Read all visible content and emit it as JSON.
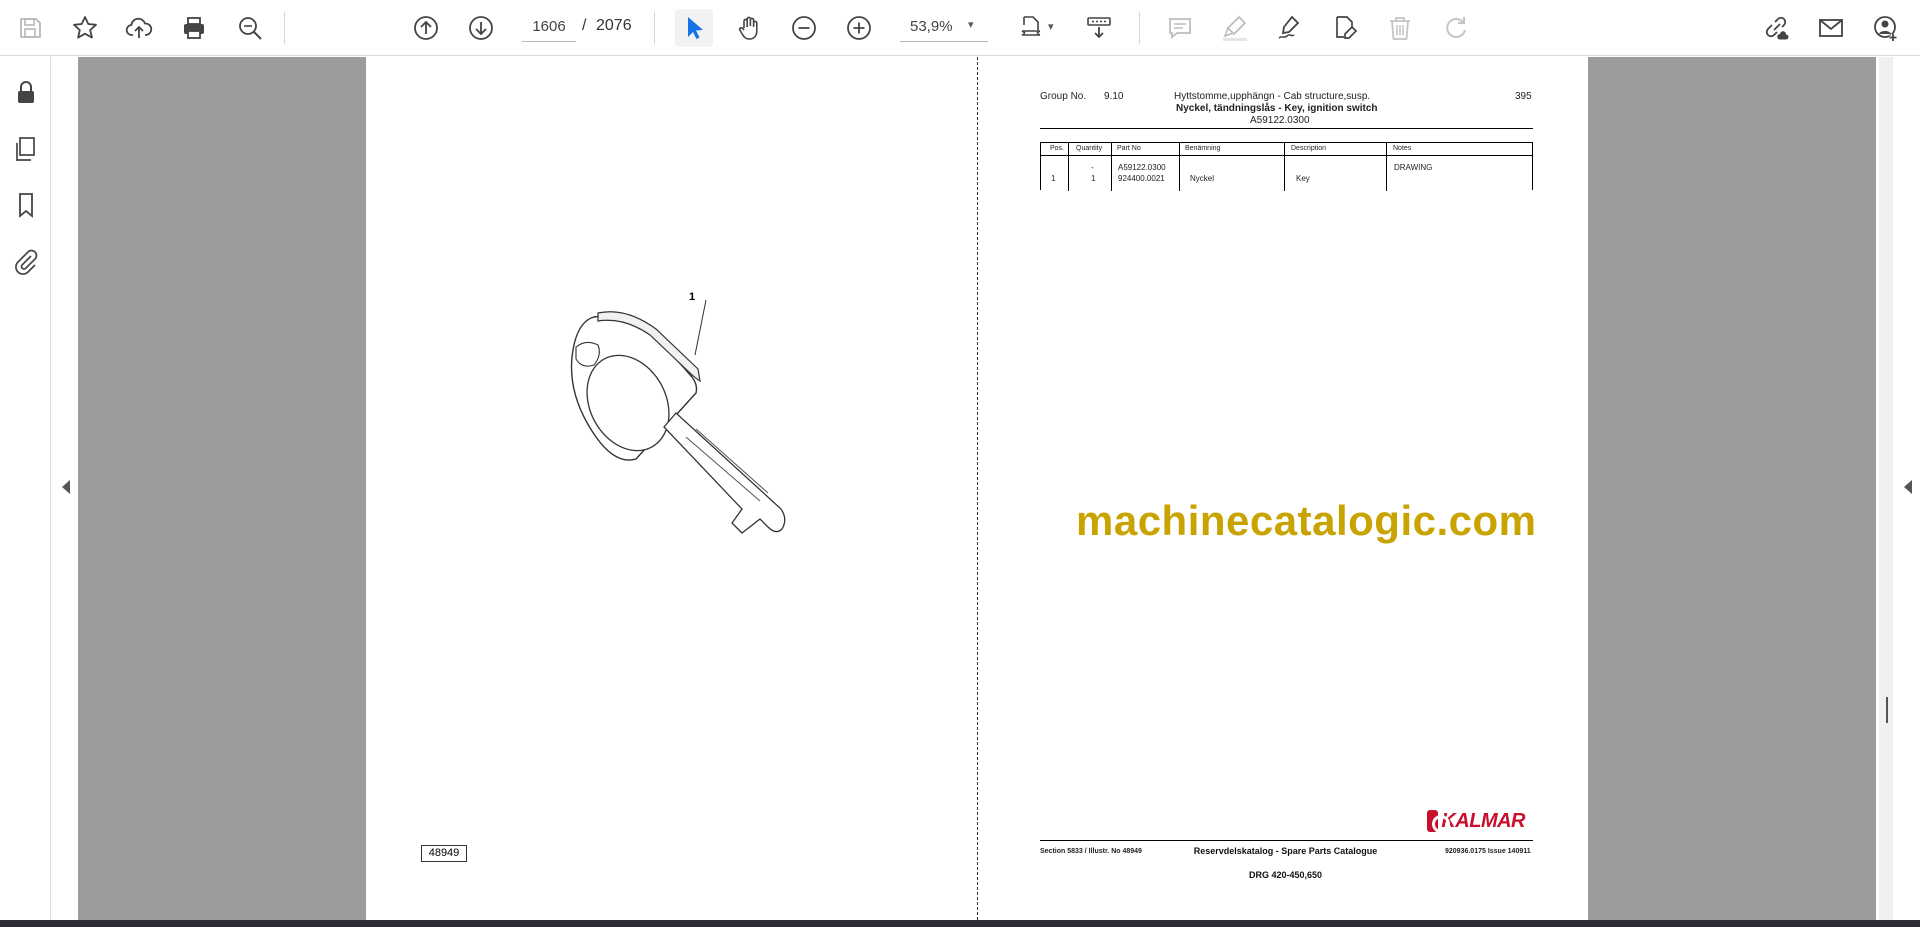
{
  "toolbar": {
    "current_page": "1606",
    "separator": "/",
    "total_pages": "2076",
    "zoom": "53,9%",
    "zoom_caret": "▾"
  },
  "document": {
    "illustration": {
      "callout": "1",
      "illustration_number": "48949"
    },
    "header": {
      "group_label": "Group No.",
      "group_no": "9.10",
      "group_name": "Hyttstomme,upphängn - Cab structure,susp.",
      "page_no": "395",
      "title": "Nyckel, tändningslås - Key, ignition switch",
      "drawing_no": "A59122.0300"
    },
    "table": {
      "headers": [
        "Pos.",
        "Quantity",
        "Part No",
        "Benämning",
        "Description",
        "Notes"
      ],
      "rows": [
        {
          "pos": "",
          "qty": "-",
          "part_no": "A59122.0300",
          "ben": "",
          "desc": "",
          "notes": "DRAWING"
        },
        {
          "pos": "1",
          "qty": "1",
          "part_no": "924400.0021",
          "ben": "Nyckel",
          "desc": "Key",
          "notes": ""
        }
      ]
    },
    "footer": {
      "brand": "KALMAR",
      "section": "Section   5833 / Illustr. No   48949",
      "catalogue": "Reservdelskatalog - Spare Parts Catalogue",
      "issue": "920936.0175 Issue 140911",
      "model": "DRG 420-450,650"
    }
  },
  "watermark": "machinecatalogic.com",
  "icons": {
    "toolbar": [
      "save-icon",
      "star-icon",
      "upload-cloud-icon",
      "print-icon",
      "search-zoom-icon",
      "arrow-up-circle-icon",
      "arrow-down-circle-icon",
      "pointer-icon",
      "hand-icon",
      "zoom-out-icon",
      "zoom-in-icon",
      "fit-page-icon",
      "scroll-mode-icon",
      "comment-icon",
      "highlight-icon",
      "sign-icon",
      "edit-doc-icon",
      "trash-icon",
      "redo-icon",
      "share-link-icon",
      "email-icon",
      "add-user-icon"
    ],
    "rail": [
      "lock-icon",
      "pages-icon",
      "bookmark-icon",
      "attachment-icon"
    ]
  },
  "colors": {
    "accent": "#1473e6",
    "watermark": "#c9a300",
    "brand_red": "#c8102e",
    "workspace_gray": "#9c9c9c"
  }
}
